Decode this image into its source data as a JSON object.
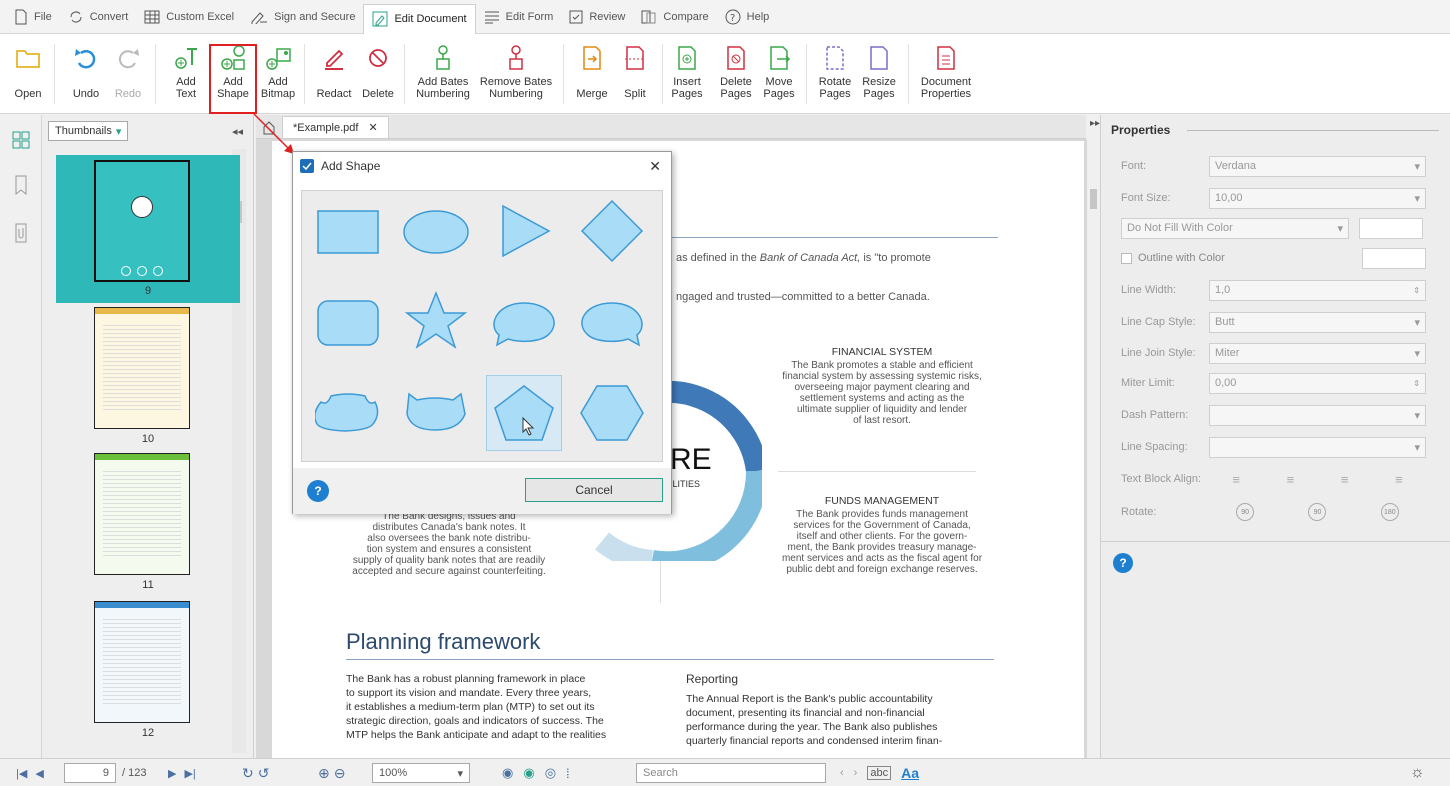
{
  "tabs": [
    {
      "label": "File",
      "icon": "file-icon"
    },
    {
      "label": "Convert",
      "icon": "convert-icon"
    },
    {
      "label": "Custom Excel",
      "icon": "table-icon"
    },
    {
      "label": "Sign and Secure",
      "icon": "sign-icon"
    },
    {
      "label": "Edit Document",
      "icon": "edit-document-icon",
      "active": true
    },
    {
      "label": "Edit Form",
      "icon": "form-icon"
    },
    {
      "label": "Review",
      "icon": "review-icon"
    },
    {
      "label": "Compare",
      "icon": "compare-icon"
    },
    {
      "label": "Help",
      "icon": "help-icon"
    }
  ],
  "ribbon": {
    "open": "Open",
    "undo": "Undo",
    "redo": "Redo",
    "add_text": "Add\nText",
    "add_shape": "Add\nShape",
    "add_bitmap": "Add\nBitmap",
    "redact": "Redact",
    "delete": "Delete",
    "add_bates": "Add Bates\nNumbering",
    "remove_bates": "Remove Bates\nNumbering",
    "merge": "Merge",
    "split": "Split",
    "insert_pages": "Insert\nPages",
    "delete_pages": "Delete\nPages",
    "move_pages": "Move\nPages",
    "rotate_pages": "Rotate\nPages",
    "resize_pages": "Resize\nPages",
    "doc_props": "Document\nProperties"
  },
  "thumbs": {
    "dropdown": "Thumbnails",
    "pages": [
      "9",
      "10",
      "11",
      "12"
    ]
  },
  "doc": {
    "tab": "*Example.pdf",
    "line1_a": "as defined in the ",
    "line1_b": "Bank of Canada Act,",
    "line1_c": " is \"to promote",
    "line2": "ngaged and trusted—committed to a better Canada.",
    "fs_title": "FINANCIAL SYSTEM",
    "fs_body": [
      "The Bank promotes a stable and efficient",
      "financial system by assessing systemic risks,",
      "overseeing major payment clearing and",
      "settlement systems and acting as the",
      "ultimate supplier of liquidity and lender",
      "of last resort."
    ],
    "core_big": "RE",
    "core_small": "ILITIES",
    "fm_title": "FUNDS MANAGEMENT",
    "fm_body": [
      "The Bank provides funds management",
      "services for the Government of Canada,",
      "itself and other clients. For the govern-",
      "ment, the Bank provides treasury manage-",
      "ment services and acts as the fiscal agent for",
      "public debt and foreign exchange reserves."
    ],
    "notes_body": [
      "The Bank designs, issues and",
      "distributes Canada's bank notes. It",
      "also oversees the bank note distribu-",
      "tion system and ensures a consistent",
      "supply of quality bank notes that are readily",
      "accepted and secure against counterfeiting."
    ],
    "planning_title": "Planning framework",
    "planning_body": [
      "The Bank has a robust planning framework in place",
      "to support its vision and mandate. Every three years,",
      "it establishes a medium-term plan (MTP) to set out its",
      "strategic direction, goals and indicators of success. The",
      "MTP helps the Bank anticipate and adapt to the realities"
    ],
    "reporting_title": "Reporting",
    "reporting_body": [
      "The Annual Report is the Bank's public accountability",
      "document, presenting its financial and non-financial",
      "performance during the year. The Bank also publishes",
      "quarterly financial reports and condensed interim finan-"
    ]
  },
  "properties": {
    "title": "Properties",
    "font_label": "Font:",
    "font_value": "Verdana",
    "size_label": "Font Size:",
    "size_value": "10,00",
    "fill_value": "Do Not Fill With Color",
    "outline_label": "Outline with Color",
    "line_width_label": "Line Width:",
    "line_width_value": "1,0",
    "cap_label": "Line Cap Style:",
    "cap_value": "Butt",
    "join_label": "Line Join Style:",
    "join_value": "Miter",
    "miter_label": "Miter Limit:",
    "miter_value": "0,00",
    "dash_label": "Dash Pattern:",
    "spacing_label": "Line Spacing:",
    "align_label": "Text Block Align:",
    "rotate_label": "Rotate:",
    "rot_90a": "90",
    "rot_90b": "90",
    "rot_180": "180"
  },
  "status": {
    "page": "9",
    "total": "/ 123",
    "zoom": "100%",
    "search_placeholder": "Search",
    "abc": "abc",
    "aa": "Aa"
  },
  "dialog": {
    "title": "Add Shape",
    "cancel": "Cancel",
    "shapes": [
      "rectangle",
      "ellipse",
      "triangle",
      "diamond",
      "rounded-rectangle",
      "star",
      "speech-bubble-left",
      "speech-bubble-right",
      "wave-ellipse",
      "double-bubble",
      "pentagon",
      "hexagon"
    ]
  },
  "colors": {
    "accent": "#3a7abf",
    "shape_fill": "#a9dcf7",
    "shape_stroke": "#3d9ad6",
    "highlight": "#e02020",
    "thumb_sel": "#2fb8b8",
    "ring_dark": "#3f79b8",
    "ring_light": "#7fbfdd"
  }
}
